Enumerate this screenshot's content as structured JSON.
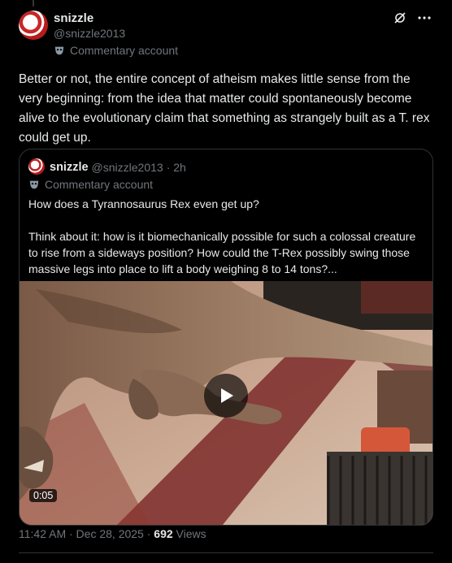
{
  "author": {
    "name": "snizzle",
    "handle": "@snizzle2013",
    "label": "Commentary account"
  },
  "tweet": {
    "text": "Better or not, the entire concept of atheism makes little sense from the very beginning: from the idea that matter could spontaneously become alive to the evolutionary claim that something as strangely built as a T. rex could get up."
  },
  "quote": {
    "name": "snizzle",
    "handle": "@snizzle2013",
    "time": "· 2h",
    "label": "Commentary account",
    "para1": "How does a Tyrannosaurus Rex even get up?",
    "para2": "Think about it: how is it biomechanically possible for such a colossal creature to rise from a sideways position? How could the T-Rex possibly swing those massive legs into place to lift a body weighing 8 to 14 tons?...",
    "video_duration": "0:05"
  },
  "meta": {
    "timestamp": "11:42 AM · Dec 28, 2025 ·",
    "views_count": "692",
    "views_label": "Views"
  },
  "icons": {
    "grok": "grok-icon",
    "more": "more-icon",
    "mask": "mask-icon",
    "play": "play-icon"
  }
}
